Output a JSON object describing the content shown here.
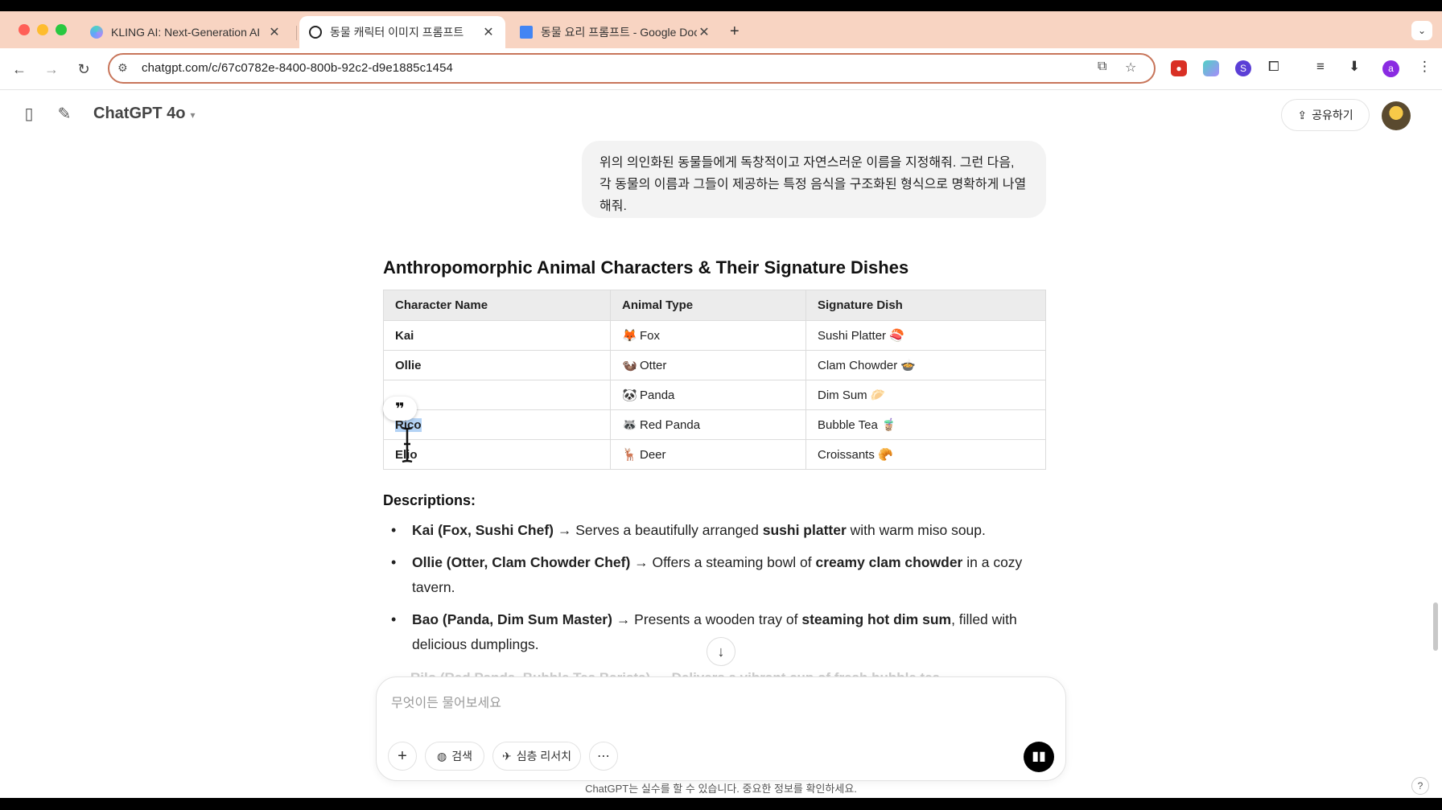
{
  "browser": {
    "tabs": [
      {
        "title": "KLING AI: Next-Generation AI",
        "active": false
      },
      {
        "title": "동물 캐릭터 이미지 프롬프트",
        "active": true
      },
      {
        "title": "동물 요리 프롬프트 - Google Doc",
        "active": false
      }
    ],
    "url": "chatgpt.com/c/67c0782e-8400-800b-92c2-d9e1885c1454",
    "profile_initial": "a"
  },
  "app": {
    "model_name": "ChatGPT 4o",
    "share_label": "공유하기"
  },
  "user_message": "위의 의인화된 동물들에게 독창적이고 자연스러운 이름을 지정해줘. 그런 다음, 각 동물의 이름과 그들이 제공하는 특정 음식을 구조화된 형식으로 명확하게 나열해줘.",
  "response": {
    "title": "Anthropomorphic Animal Characters & Their Signature Dishes",
    "table": {
      "headers": [
        "Character Name",
        "Animal Type",
        "Signature Dish"
      ],
      "rows": [
        {
          "name": "Kai",
          "animal": "Fox",
          "animal_emoji": "🦊",
          "dish": "Sushi Platter",
          "dish_emoji": "🍣"
        },
        {
          "name": "Ollie",
          "animal": "Otter",
          "animal_emoji": "🦦",
          "dish": "Clam Chowder",
          "dish_emoji": "🍲"
        },
        {
          "name": "",
          "animal": "Panda",
          "animal_emoji": "🐼",
          "dish": "Dim Sum",
          "dish_emoji": "🥟"
        },
        {
          "name": "Rico",
          "animal": "Red Panda",
          "animal_emoji": "🦝",
          "dish": "Bubble Tea",
          "dish_emoji": "🧋"
        },
        {
          "name": "Elio",
          "animal": "Deer",
          "animal_emoji": "🦌",
          "dish": "Croissants",
          "dish_emoji": "🥐"
        }
      ]
    },
    "descriptions_title": "Descriptions:",
    "descriptions": [
      {
        "lead": "Kai (Fox, Sushi Chef)",
        "pre": " → Serves a beautifully arranged ",
        "bold": "sushi platter",
        "post": " with warm miso soup."
      },
      {
        "lead": "Ollie (Otter, Clam Chowder Chef)",
        "pre": " → Offers a steaming bowl of ",
        "bold": "creamy clam chowder",
        "post": " in a cozy tavern."
      },
      {
        "lead": "Bao (Panda, Dim Sum Master)",
        "pre": " → Presents a wooden tray of ",
        "bold": "steaming hot dim sum",
        "post": ", filled with delicious dumplings."
      }
    ],
    "cut_off_line": "Rilo (Red Panda, Bubble Tea Barista) → Delivers a vibrant cup of fresh bubble tea"
  },
  "composer": {
    "placeholder": "무엇이든 물어보세요",
    "search_label": "검색",
    "deep_research_label": "심층 리서치"
  },
  "disclaimer": "ChatGPT는 실수를 할 수 있습니다. 중요한 정보를 확인하세요.",
  "help_label": "?"
}
